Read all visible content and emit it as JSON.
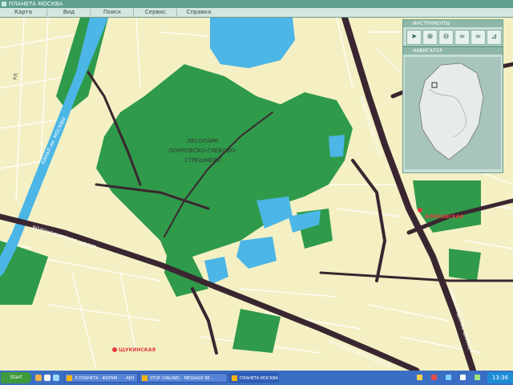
{
  "window": {
    "title": "ПЛАНЕТА МОСКВА"
  },
  "menu": [
    "Карта",
    "Вид",
    "Поиск",
    "Сервис",
    "Справка"
  ],
  "map": {
    "park_label": [
      "ЛЕСОПАРК",
      "ПОКРОВСКО-ГЛЕБОВО-",
      "СТРЕШНЕВО"
    ],
    "canal_label": "КАНАЛ им. МОСКВЫ",
    "roads": {
      "volokolamskoe_1": "ВОЛОКОЛАМСКОЕ ШОССЕ",
      "volokolamskoe_2": "ВОЛОКОЛАМСКОЕ ШОССЕ",
      "leningradskoe_1": "ЛЕНИНГРАДСКОЕ ШОССЕ",
      "leningradskoe_2": "ЛЕНИНГРАДСКОЕ ШОССЕ",
      "ul_small": "УЛ."
    },
    "metro": [
      "ВОЙКОВСКАЯ",
      "ЩУКИНСКАЯ"
    ],
    "colors": {
      "background": "#f4f0c4",
      "park": "#2f9a4a",
      "water": "#4cb6e6",
      "road": "#3a2630",
      "metro": "#e23c3c"
    }
  },
  "tools_panel": {
    "title": "ИНСТРУМЕНТЫ",
    "buttons": [
      "arrow-pointer-icon",
      "zoom-in-icon",
      "zoom-out-icon",
      "binoculars-icon",
      "binoculars-alt-icon",
      "ruler-icon"
    ]
  },
  "navigator_panel": {
    "title": "НАВИГАТОР"
  },
  "taskbar": {
    "start": "Start",
    "tasks": [
      "Л.ПЛАНЕТА · ФОРУМ · · · АЕН",
      "STOP (ONLINE) - MESSAGE BE...",
      "ПЛАНЕТА МОСКВА"
    ],
    "clock": "13:36"
  }
}
